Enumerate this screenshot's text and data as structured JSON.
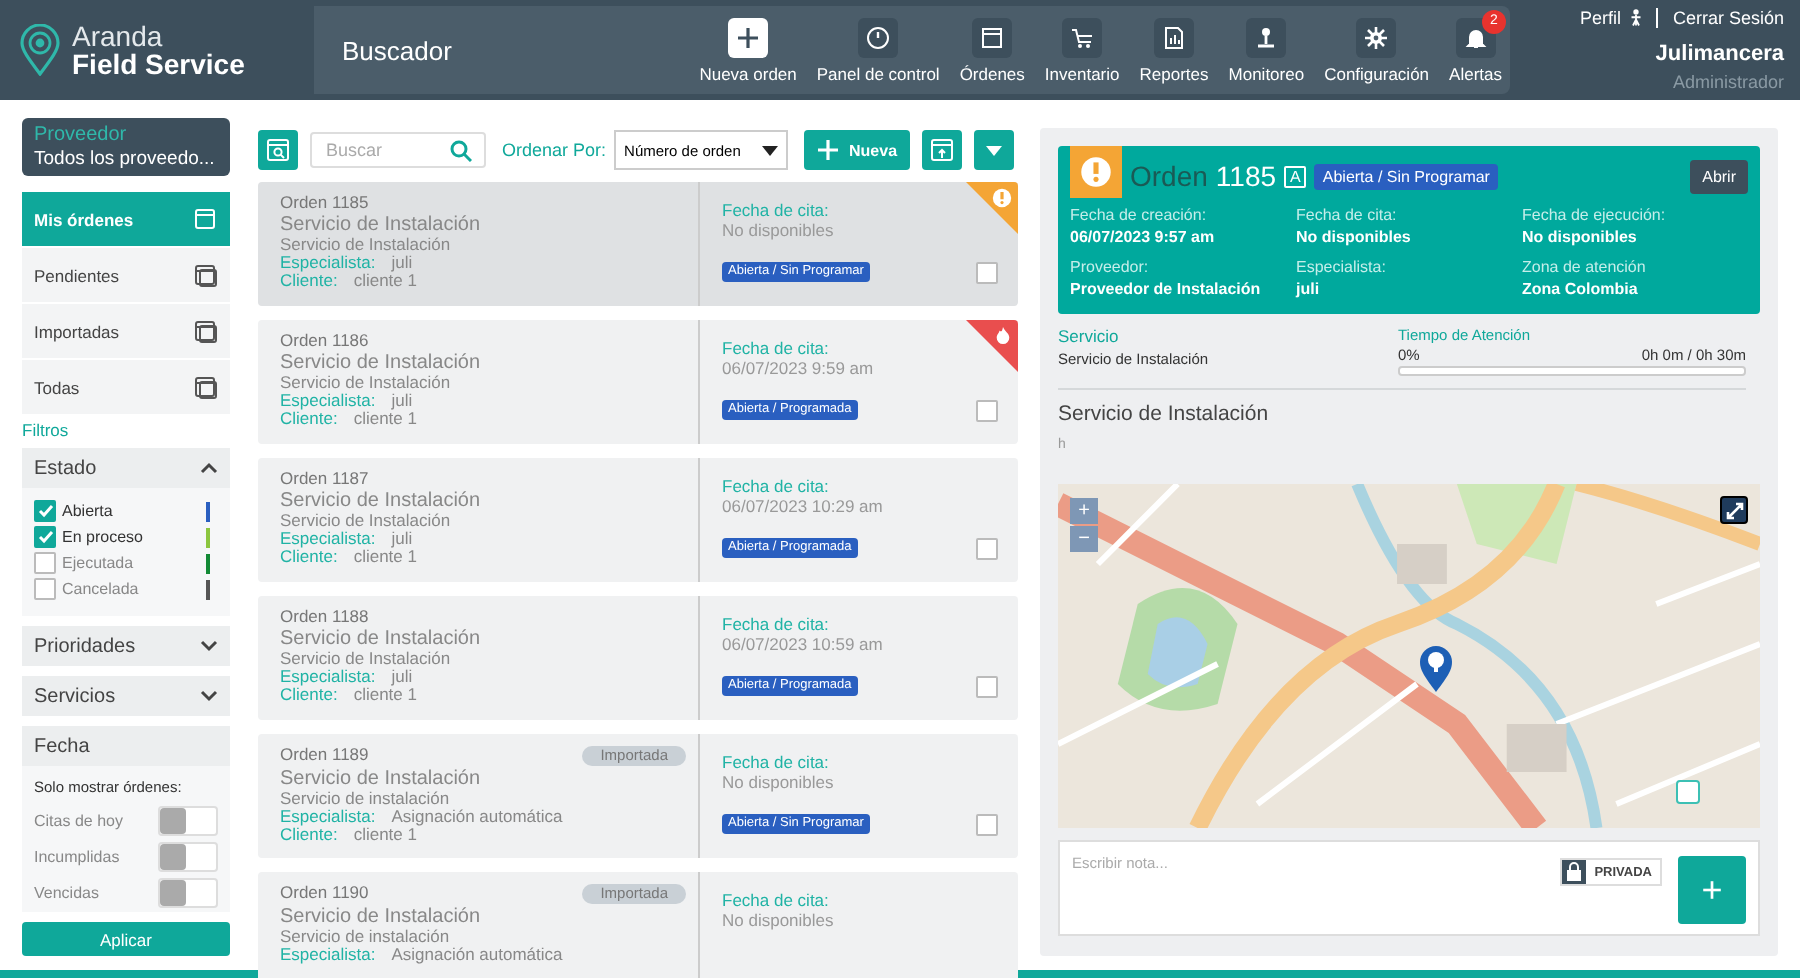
{
  "brand": {
    "line1": "Aranda",
    "line2": "Field Service"
  },
  "section": "Buscador",
  "nav": [
    {
      "label": "Nueva orden",
      "kind": "primary"
    },
    {
      "label": "Panel de control",
      "kind": "normal"
    },
    {
      "label": "Órdenes",
      "kind": "normal"
    },
    {
      "label": "Inventario",
      "kind": "normal"
    },
    {
      "label": "Reportes",
      "kind": "normal"
    },
    {
      "label": "Monitoreo",
      "kind": "normal"
    },
    {
      "label": "Configuración",
      "kind": "normal"
    },
    {
      "label": "Alertas",
      "kind": "normal",
      "badge": "2"
    }
  ],
  "user": {
    "profile": "Perfil",
    "logout": "Cerrar Sesión",
    "name": "Julimancera",
    "role": "Administrador"
  },
  "provider": {
    "label": "Proveedor",
    "value": "Todos los proveedo..."
  },
  "views": [
    {
      "label": "Mis órdenes",
      "selected": true
    },
    {
      "label": "Pendientes",
      "selected": false
    },
    {
      "label": "Importadas",
      "selected": false
    },
    {
      "label": "Todas",
      "selected": false
    }
  ],
  "filters_label": "Filtros",
  "state_filter": {
    "title": "Estado",
    "expanded": true,
    "options": [
      {
        "label": "Abierta",
        "checked": true,
        "color": "#2a5fc0"
      },
      {
        "label": "En proceso",
        "checked": true,
        "color": "#8cc63f"
      },
      {
        "label": "Ejecutada",
        "checked": false,
        "color": "#138a36"
      },
      {
        "label": "Cancelada",
        "checked": false,
        "color": "#555555"
      }
    ]
  },
  "collapsed_filters": [
    {
      "title": "Prioridades",
      "expanded": false
    },
    {
      "title": "Servicios",
      "expanded": false
    }
  ],
  "date_filter": {
    "title": "Fecha",
    "hint": "Solo mostrar órdenes:",
    "toggles": [
      {
        "label": "Citas de hoy",
        "on": false
      },
      {
        "label": "Incumplidas",
        "on": false
      },
      {
        "label": "Vencidas",
        "on": false
      }
    ]
  },
  "apply_button": "Aplicar",
  "toolbar": {
    "search_placeholder": "Buscar",
    "sort_label": "Ordenar Por:",
    "sort_value": "Número de orden",
    "new_button": "Nueva"
  },
  "orders": [
    {
      "number": "Orden 1185",
      "title": "Servicio de Instalación",
      "subtitle": "Servicio de Instalación",
      "specialist_label": "Especialista:",
      "specialist": "juli",
      "client_label": "Cliente:",
      "client": "cliente 1",
      "date_label": "Fecha de cita:",
      "date": "No disponibles",
      "status": "Abierta / Sin Programar",
      "kind": "warning",
      "selected": true,
      "checked": false
    },
    {
      "number": "Orden 1186",
      "title": "Servicio de Instalación",
      "subtitle": "Servicio de Instalación",
      "specialist_label": "Especialista:",
      "specialist": "juli",
      "client_label": "Cliente:",
      "client": "cliente 1",
      "date_label": "Fecha de cita:",
      "date": "06/07/2023 9:59 am",
      "status": "Abierta / Programada",
      "kind": "fire",
      "selected": false,
      "checked": false
    },
    {
      "number": "Orden 1187",
      "title": "Servicio de Instalación",
      "subtitle": "Servicio de Instalación",
      "specialist_label": "Especialista:",
      "specialist": "juli",
      "client_label": "Cliente:",
      "client": "cliente 1",
      "date_label": "Fecha de cita:",
      "date": "06/07/2023 10:29 am",
      "status": "Abierta / Programada",
      "kind": "plain",
      "selected": false,
      "checked": false
    },
    {
      "number": "Orden 1188",
      "title": "Servicio de Instalación",
      "subtitle": "Servicio de Instalación",
      "specialist_label": "Especialista:",
      "specialist": "juli",
      "client_label": "Cliente:",
      "client": "cliente 1",
      "date_label": "Fecha de cita:",
      "date": "06/07/2023 10:59 am",
      "status": "Abierta / Programada",
      "kind": "plain",
      "selected": false,
      "checked": false
    },
    {
      "number": "Orden 1189",
      "title": "Servicio de Instalación",
      "subtitle": "Servicio de instalación",
      "specialist_label": "Especialista:",
      "specialist": "Asignación automática",
      "client_label": "Cliente:",
      "client": "cliente 1",
      "date_label": "Fecha de cita:",
      "date": "No disponibles",
      "status": "Abierta / Sin Programar",
      "tag": "Importada",
      "kind": "plain",
      "selected": false,
      "checked": false
    },
    {
      "number": "Orden 1190",
      "title": "Servicio de Instalación",
      "subtitle": "Servicio de instalación",
      "specialist_label": "Especialista:",
      "specialist": "Asignación automática",
      "date_label": "Fecha de cita:",
      "date": "No disponibles",
      "tag": "Importada",
      "kind": "plain",
      "selected": false
    }
  ],
  "detail": {
    "kind": "warning",
    "title": "Orden",
    "number": "1185",
    "letter": "A",
    "status": "Abierta / Sin Programar",
    "open_button": "Abrir",
    "fields": [
      {
        "label": "Fecha de creación:",
        "value": "06/07/2023 9:57 am"
      },
      {
        "label": "Fecha de cita:",
        "value": "No disponibles"
      },
      {
        "label": "Fecha de ejecución:",
        "value": "No disponibles"
      },
      {
        "label": "Proveedor:",
        "value": "Proveedor de Instalación"
      },
      {
        "label": "Especialista:",
        "value": "juli"
      },
      {
        "label": "Zona de atención",
        "value": "Zona Colombia"
      }
    ],
    "service_label": "Servicio",
    "service_value": "Servicio de Instalación",
    "time_label": "Tiempo de Atención",
    "time_percent": "0%",
    "time_reading": "0h 0m / 0h 30m",
    "level": 0,
    "description_title": "Servicio de Instalación",
    "description_body": "h",
    "map_zoom_in": "+",
    "map_zoom_out": "−",
    "map_layer_checked": false,
    "note_placeholder": "Escribir nota...",
    "private_label": "PRIVADA",
    "add_note": "+"
  }
}
